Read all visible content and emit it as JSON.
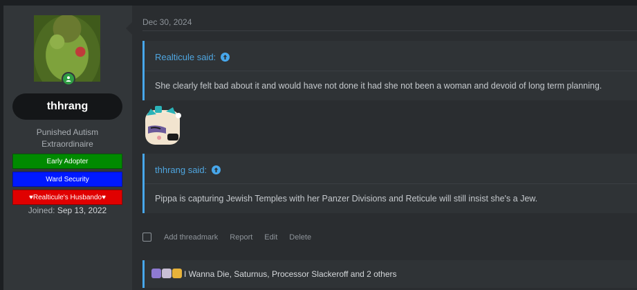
{
  "user": {
    "username": "thhrang",
    "title_line1": "Punished Autism",
    "title_line2": "Extraordinaire",
    "banners": [
      "Early Adopter",
      "Ward Security",
      "♥Realticule's Husbando♥"
    ],
    "joined_label": "Joined:",
    "joined_date": "Sep 13, 2022"
  },
  "post": {
    "date": "Dec 30, 2024",
    "quotes": [
      {
        "author": "Realticule said:",
        "text": "She clearly felt bad about it and would have not done it had she not been a woman and devoid of long term planning."
      },
      {
        "author": "thhrang said:",
        "text": "Pippa is capturing Jewish Temples with her Panzer Divisions and Reticule will still insist she's a Jew."
      }
    ]
  },
  "actions": {
    "threadmark": "Add threadmark",
    "report": "Report",
    "edit": "Edit",
    "delete": "Delete"
  },
  "reactions": {
    "text": "I Wanna Die, Saturnus, Processor Slackeroff and 2 others"
  },
  "colors": {
    "accent": "#47a7eb",
    "banner_green": "#008a00",
    "banner_blue": "#0019ff",
    "banner_red": "#e00000",
    "online": "#2f9e44"
  }
}
